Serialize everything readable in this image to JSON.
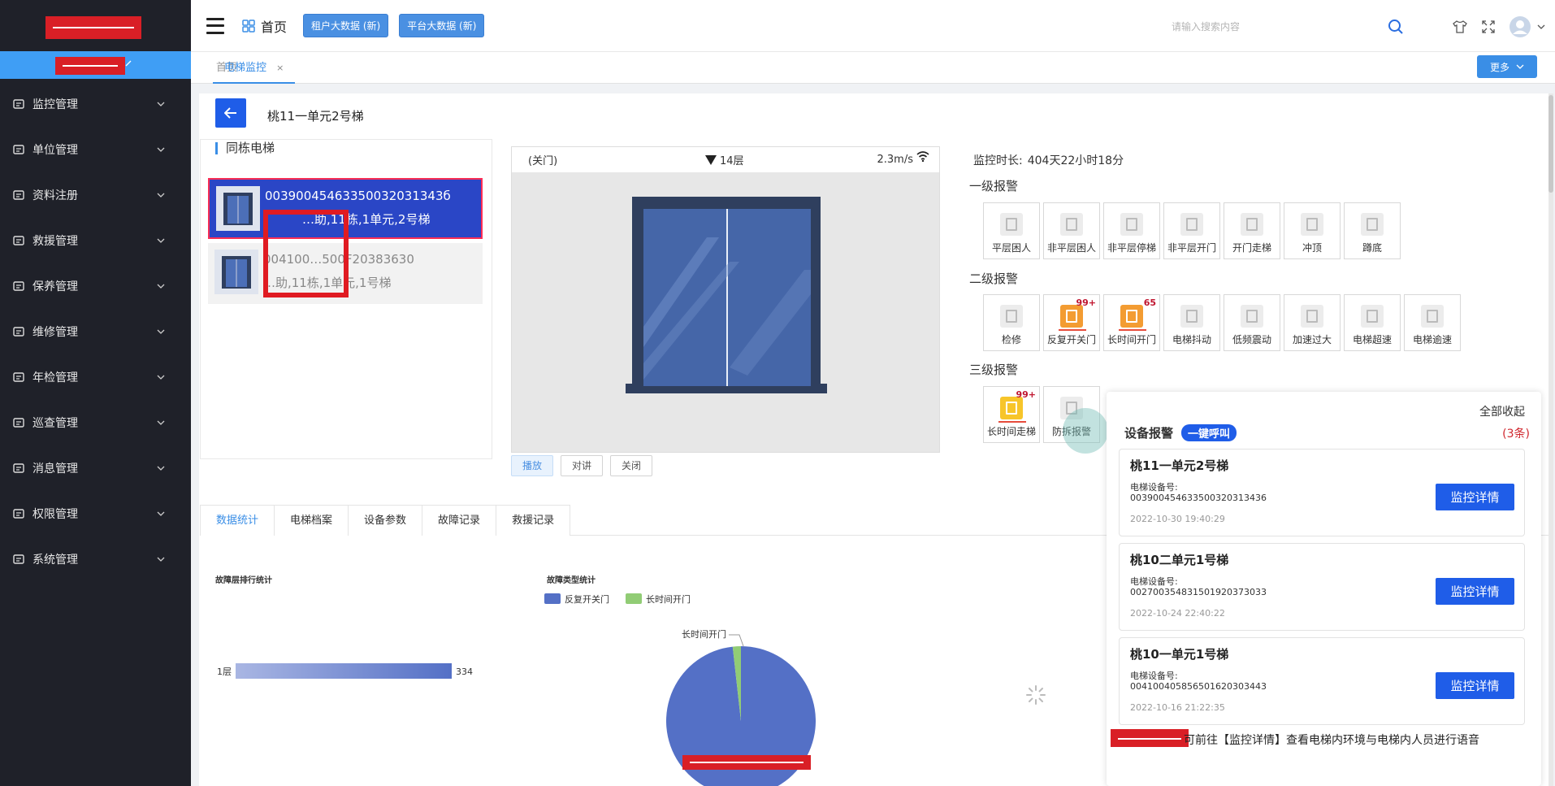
{
  "topbar": {
    "home_label": "首页",
    "btn_tenant": "租户大数据 (新)",
    "btn_platform": "平台大数据 (新)",
    "search_placeholder": "请输入搜索内容"
  },
  "sidebar": {
    "items": [
      {
        "label": "监控管理",
        "icon": "monitor-icon"
      },
      {
        "label": "单位管理",
        "icon": "building-icon"
      },
      {
        "label": "资料注册",
        "icon": "edit-icon"
      },
      {
        "label": "救援管理",
        "icon": "rescue-icon"
      },
      {
        "label": "保养管理",
        "icon": "maintain-icon"
      },
      {
        "label": "维修管理",
        "icon": "repair-icon"
      },
      {
        "label": "年检管理",
        "icon": "inspect-icon"
      },
      {
        "label": "巡查管理",
        "icon": "patrol-icon"
      },
      {
        "label": "消息管理",
        "icon": "message-icon"
      },
      {
        "label": "权限管理",
        "icon": "user-icon"
      },
      {
        "label": "系统管理",
        "icon": "system-icon"
      }
    ]
  },
  "tabs": {
    "home": "首页",
    "monitor": "电梯监控",
    "close": "×",
    "more": "更多"
  },
  "page": {
    "elevator_title": "桃11一单元2号梯",
    "same_building_title": "同栋电梯",
    "elevators": [
      {
        "code": "00390045463350032031343б",
        "desc": "…助,11栋,1单元,2号梯"
      },
      {
        "code": "004100…500F20383630",
        "desc": "…助,11栋,1单元,1号梯"
      }
    ]
  },
  "video": {
    "door_state": "(关门)",
    "floor": "14层",
    "speed": "2.3m/s",
    "btn_play": "播放",
    "btn_talk": "对讲",
    "btn_close": "关闭"
  },
  "alarms": {
    "monitor_label": "监控时长:",
    "monitor_value": "404天22小时18分",
    "level1_title": "一级报警",
    "level1": [
      "平层困人",
      "非平层困人",
      "非平层停梯",
      "非平层开门",
      "开门走梯",
      "冲顶",
      "蹲底"
    ],
    "level2_title": "二级报警",
    "level2": [
      {
        "label": "检修",
        "badge": ""
      },
      {
        "label": "反复开关门",
        "badge": "99+"
      },
      {
        "label": "长时间开门",
        "badge": "65"
      },
      {
        "label": "电梯抖动",
        "badge": ""
      },
      {
        "label": "低频震动",
        "badge": ""
      },
      {
        "label": "加速过大",
        "badge": ""
      },
      {
        "label": "电梯超速",
        "badge": ""
      },
      {
        "label": "电梯逾速",
        "badge": ""
      }
    ],
    "level3_title": "三级报警",
    "level3": [
      {
        "label": "长时间走梯",
        "badge": "99+"
      },
      {
        "label": "防拆报警",
        "badge": ""
      }
    ]
  },
  "bottom_tabs": [
    "数据统计",
    "电梯档案",
    "设备参数",
    "故障记录",
    "救援记录"
  ],
  "charts": {
    "floor_title": "故障层排行统计",
    "type_title": "故障类型统计"
  },
  "chart_data": [
    {
      "type": "bar",
      "title": "故障层排行统计",
      "categories": [
        "1层"
      ],
      "values": [
        334
      ],
      "orientation": "horizontal",
      "color": "#8f9fd6"
    },
    {
      "type": "pie",
      "title": "故障类型统计",
      "labels": [
        "反复开关门",
        "长时间开门"
      ],
      "values": [
        334,
        6
      ],
      "colors": [
        "#5470c6",
        "#91cc75"
      ],
      "annotations": [
        "长时间开门"
      ],
      "legend": "top"
    }
  ],
  "popup": {
    "collapse_all": "全部收起",
    "title": "设备报警",
    "call_btn": "一键呼叫",
    "count": "(3条)",
    "cards": [
      {
        "name": "桃11一单元2号梯",
        "label": "电梯设备号:",
        "device": "003900454633500320313436",
        "time": "2022-10-30 19:40:29",
        "btn": "监控详情"
      },
      {
        "name": "桃10二单元1号梯",
        "label": "电梯设备号:",
        "device": "002700354831501920373033",
        "time": "2022-10-24 22:40:22",
        "btn": "监控详情"
      },
      {
        "name": "桃10一单元1号梯",
        "label": "电梯设备号:",
        "device": "004100405856501620303443",
        "time": "2022-10-16 21:22:35",
        "btn": "监控详情"
      }
    ],
    "footer": "可前往【监控详情】查看电梯内环境与电梯内人员进行语音"
  },
  "colors": {
    "sidebar_bg": "#1f2129",
    "accent": "#3a8ee6",
    "primary_btn": "#1f5de8",
    "alarm_orange": "#f39c32",
    "alarm_yellow": "#f7c52a",
    "badge_red": "#c0152f"
  }
}
